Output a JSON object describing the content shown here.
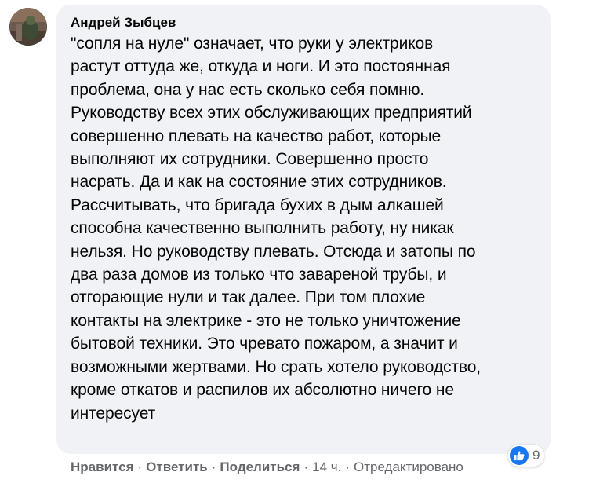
{
  "comment": {
    "author": "Андрей Зыбцев",
    "text": "\"сопля на нуле\" означает, что руки у электриков\nрастут оттуда же, откуда и ноги. И это постоянная\nпроблема, она у нас есть сколько себя помню.\nРуководству всех этих обслуживающих предприятий\nсовершенно плевать на качество работ, которые\nвыполняют их сотрудники. Совершенно просто\nнасрать. Да и как на состояние этих сотрудников.\nРассчитывать, что бригада бухих в дым алкашей\nспособна качественно выполнить работу, ну никак\nнельзя. Но руководству плевать. Отсюда и затопы по\nдва раза домов из только что завареной трубы, и\nотгорающие нули и так далее. При том плохие\nконтакты на электрике - это не только уничтожение\nбытовой техники. Это чревато пожаром, а значит и\nвозможными жертвами. Но срать хотело руководство,\nкроме откатов и распилов их абсолютно ничего не\nинтересует",
    "avatar_icon": "user-avatar-photo",
    "bubble_color": "#f0f2f5"
  },
  "reactions": {
    "icon": "like-thumb-icon",
    "count": "9",
    "color": "#1877f2"
  },
  "actions": {
    "like": "Нравится",
    "reply": "Ответить",
    "share": "Поделиться",
    "time": "14 ч.",
    "edited": "Отредактировано",
    "separator": "·"
  }
}
